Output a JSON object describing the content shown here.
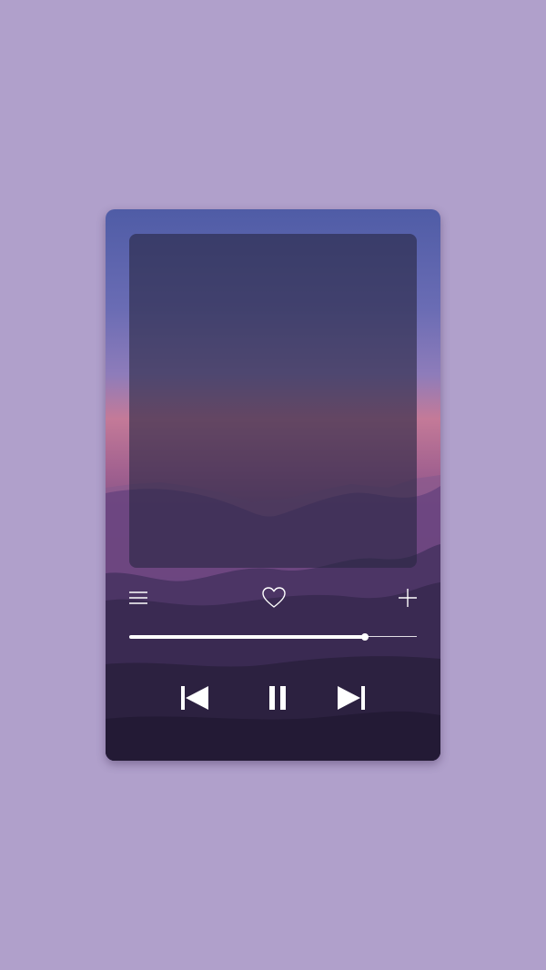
{
  "colors": {
    "page_background": "#b0a0cb",
    "sky_top": "#5560a8",
    "sky_horizon": "#c0708f",
    "mountains_dark": "#2a1f3d",
    "album_overlay": "rgba(40,38,66,0.62)",
    "icon_color": "#ffffff"
  },
  "player": {
    "progress": 0.82,
    "is_playing": true,
    "liked": false
  },
  "icons": {
    "menu": "hamburger-menu-icon",
    "heart": "heart-outline-icon",
    "add": "plus-icon",
    "previous": "skip-previous-icon",
    "pause": "pause-icon",
    "next": "skip-next-icon"
  }
}
